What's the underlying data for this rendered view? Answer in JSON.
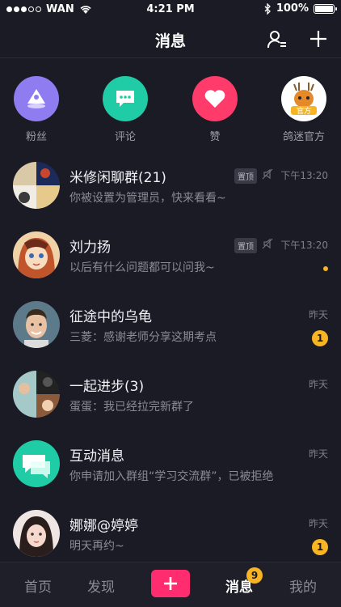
{
  "status": {
    "carrier": "WAN",
    "time": "4:21 PM",
    "battery": "100%"
  },
  "header": {
    "title": "消息"
  },
  "quick": [
    {
      "label": "粉丝",
      "color": "#8f7cf0",
      "icon": "fans-icon"
    },
    {
      "label": "评论",
      "color": "#1fcca6",
      "icon": "comment-icon"
    },
    {
      "label": "赞",
      "color": "#ff3b6b",
      "icon": "heart-icon"
    },
    {
      "label": "鸽迷官方",
      "color": "#ffffff",
      "icon": "deer-logo",
      "logo_text": "官方"
    }
  ],
  "conversations": [
    {
      "name": "米修闲聊群(21)",
      "message": "你被设置为管理员，快来看看~",
      "time": "下午13:20",
      "pinned": "置顶",
      "muted": true,
      "avatar": "group-collage-avatar"
    },
    {
      "name": "刘力扬",
      "message": "以后有什么问题都可以问我~",
      "time": "下午13:20",
      "pinned": "置顶",
      "muted": true,
      "unread_dot": true,
      "avatar": "cartoon-girl-avatar"
    },
    {
      "name": "征途中的乌龟",
      "message": "三菱：感谢老师分享这期考点",
      "time": "昨天",
      "badge": "1",
      "avatar": "man-portrait-avatar"
    },
    {
      "name": "一起进步(3)",
      "message": "蛋蛋：我已经拉完新群了",
      "time": "昨天",
      "avatar": "group-collage-avatar"
    },
    {
      "name": "互动消息",
      "message": "你申请加入群组“学习交流群”，已被拒绝",
      "time": "昨天",
      "avatar": "interactive-message-icon"
    },
    {
      "name": "娜娜@婷婷",
      "message": "明天再约~",
      "time": "昨天",
      "badge": "1",
      "avatar": "woman-portrait-avatar"
    }
  ],
  "tabs": [
    {
      "label": "首页"
    },
    {
      "label": "发现"
    },
    {
      "label": "消息",
      "active": true,
      "badge": "9"
    },
    {
      "label": "我的"
    }
  ]
}
